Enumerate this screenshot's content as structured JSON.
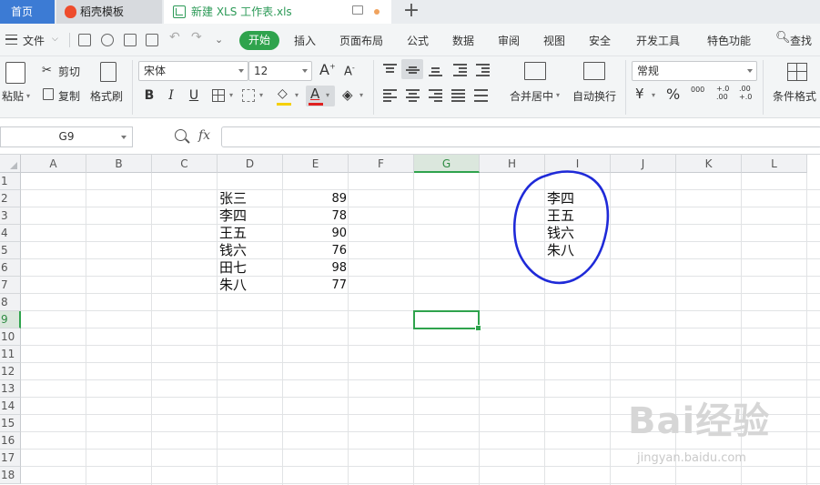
{
  "tabs": {
    "home": "首页",
    "template": "稻壳模板",
    "document": "新建 XLS 工作表.xls",
    "new_tab": "+"
  },
  "menu": {
    "file": "文件",
    "items": [
      "开始",
      "插入",
      "页面布局",
      "公式",
      "数据",
      "审阅",
      "视图",
      "安全",
      "开发工具",
      "特色功能"
    ],
    "search": "查找"
  },
  "ribbon": {
    "paste": "粘贴",
    "cut": "剪切",
    "copy": "复制",
    "format_painter": "格式刷",
    "font_name": "宋体",
    "font_size": "12",
    "bold": "B",
    "italic": "I",
    "underline": "U",
    "merge_center": "合并居中",
    "wrap_text": "自动换行",
    "number_format": "常规",
    "percent": "%",
    "thousands": "000",
    "inc_decimal": "+.0 .00",
    "dec_decimal": ".00 +.0",
    "conditional_format": "条件格式"
  },
  "formula_bar": {
    "cell_ref": "G9",
    "fx": "fx",
    "value": ""
  },
  "sheet": {
    "columns": [
      "A",
      "B",
      "C",
      "D",
      "E",
      "F",
      "G",
      "H",
      "I",
      "J",
      "K",
      "L"
    ],
    "rows": [
      "1",
      "2",
      "3",
      "4",
      "5",
      "6",
      "7",
      "8",
      "9",
      "10",
      "11",
      "12",
      "13",
      "14",
      "15",
      "16",
      "17",
      "18"
    ],
    "selected_cell": "G9",
    "names_d": [
      "张三",
      "李四",
      "王五",
      "钱六",
      "田七",
      "朱八"
    ],
    "scores_e": [
      "89",
      "78",
      "90",
      "76",
      "98",
      "77"
    ],
    "names_i": [
      "李四",
      "王五",
      "钱六",
      "朱八"
    ]
  },
  "watermark": {
    "brand": "Bai经验",
    "url": "jingyan.baidu.com"
  },
  "colors": {
    "accent_green": "#2fa34d",
    "tab_blue": "#3c7bd4",
    "annotation_blue": "#1f2ad8"
  }
}
